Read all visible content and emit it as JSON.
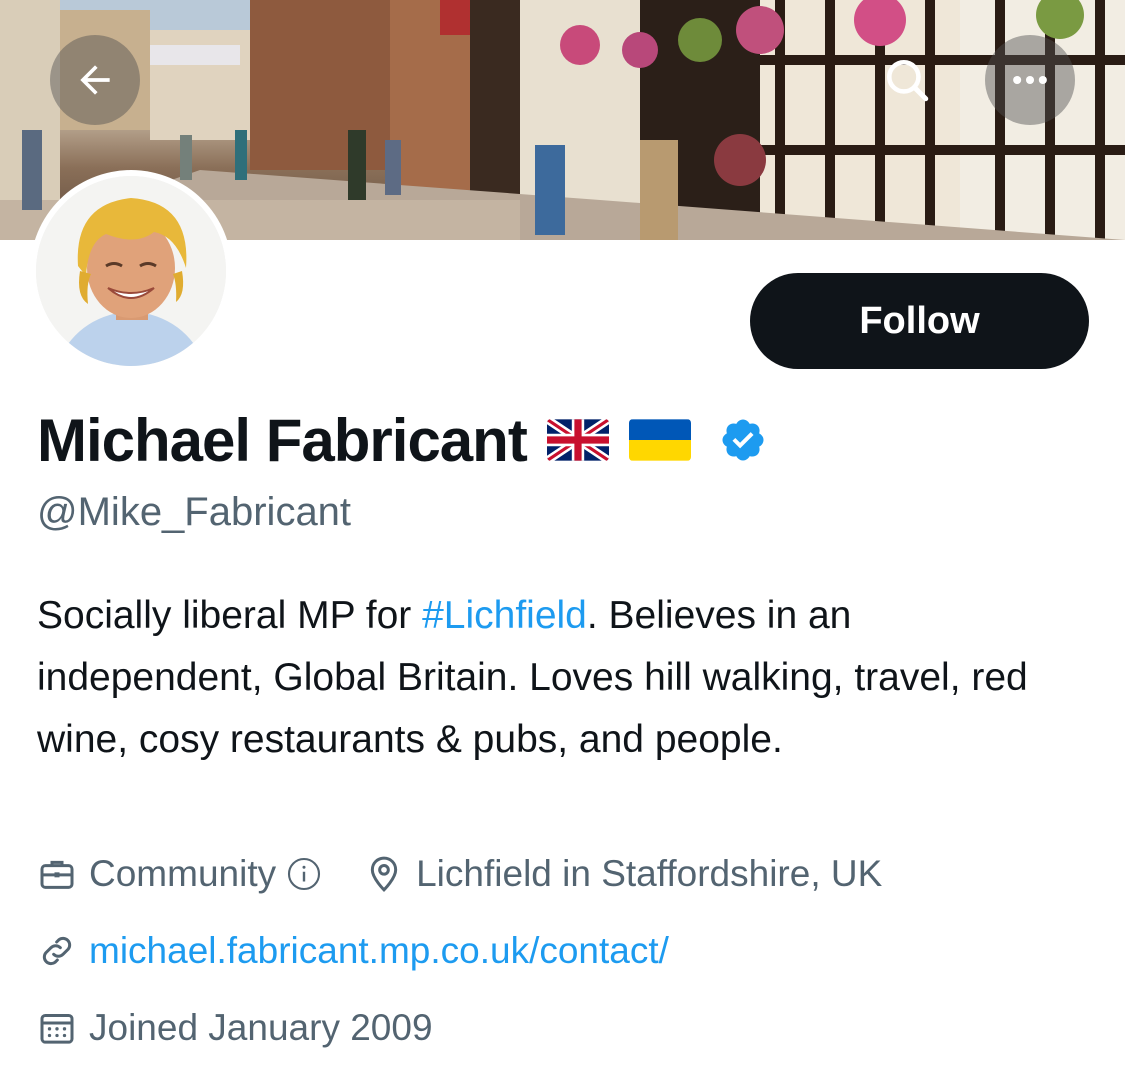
{
  "header": {
    "back_icon": "arrow-left-icon",
    "search_icon": "search-icon",
    "more_icon": "more-horizontal-icon"
  },
  "profile": {
    "display_name": "Michael Fabricant",
    "flags": [
      "united-kingdom-flag",
      "ukraine-flag"
    ],
    "verified_icon": "verified-badge-icon",
    "verified_color": "#1d9bf0",
    "handle": "@Mike_Fabricant",
    "follow_label": "Follow",
    "bio": {
      "before": "Socially liberal MP for ",
      "hashtag": "#Lichfield",
      "after": ". Believes in an independent, Global Britain. Loves hill walking, travel, red wine, cosy restaurants & pubs, and people."
    },
    "category": "Community",
    "location": "Lichfield in Staffordshire, UK",
    "website": "michael.fabricant.mp.co.uk/contact/",
    "joined": "Joined January 2009"
  },
  "colors": {
    "link": "#1d9bf0",
    "secondary_text": "#536471",
    "button_bg": "#0f1419"
  }
}
